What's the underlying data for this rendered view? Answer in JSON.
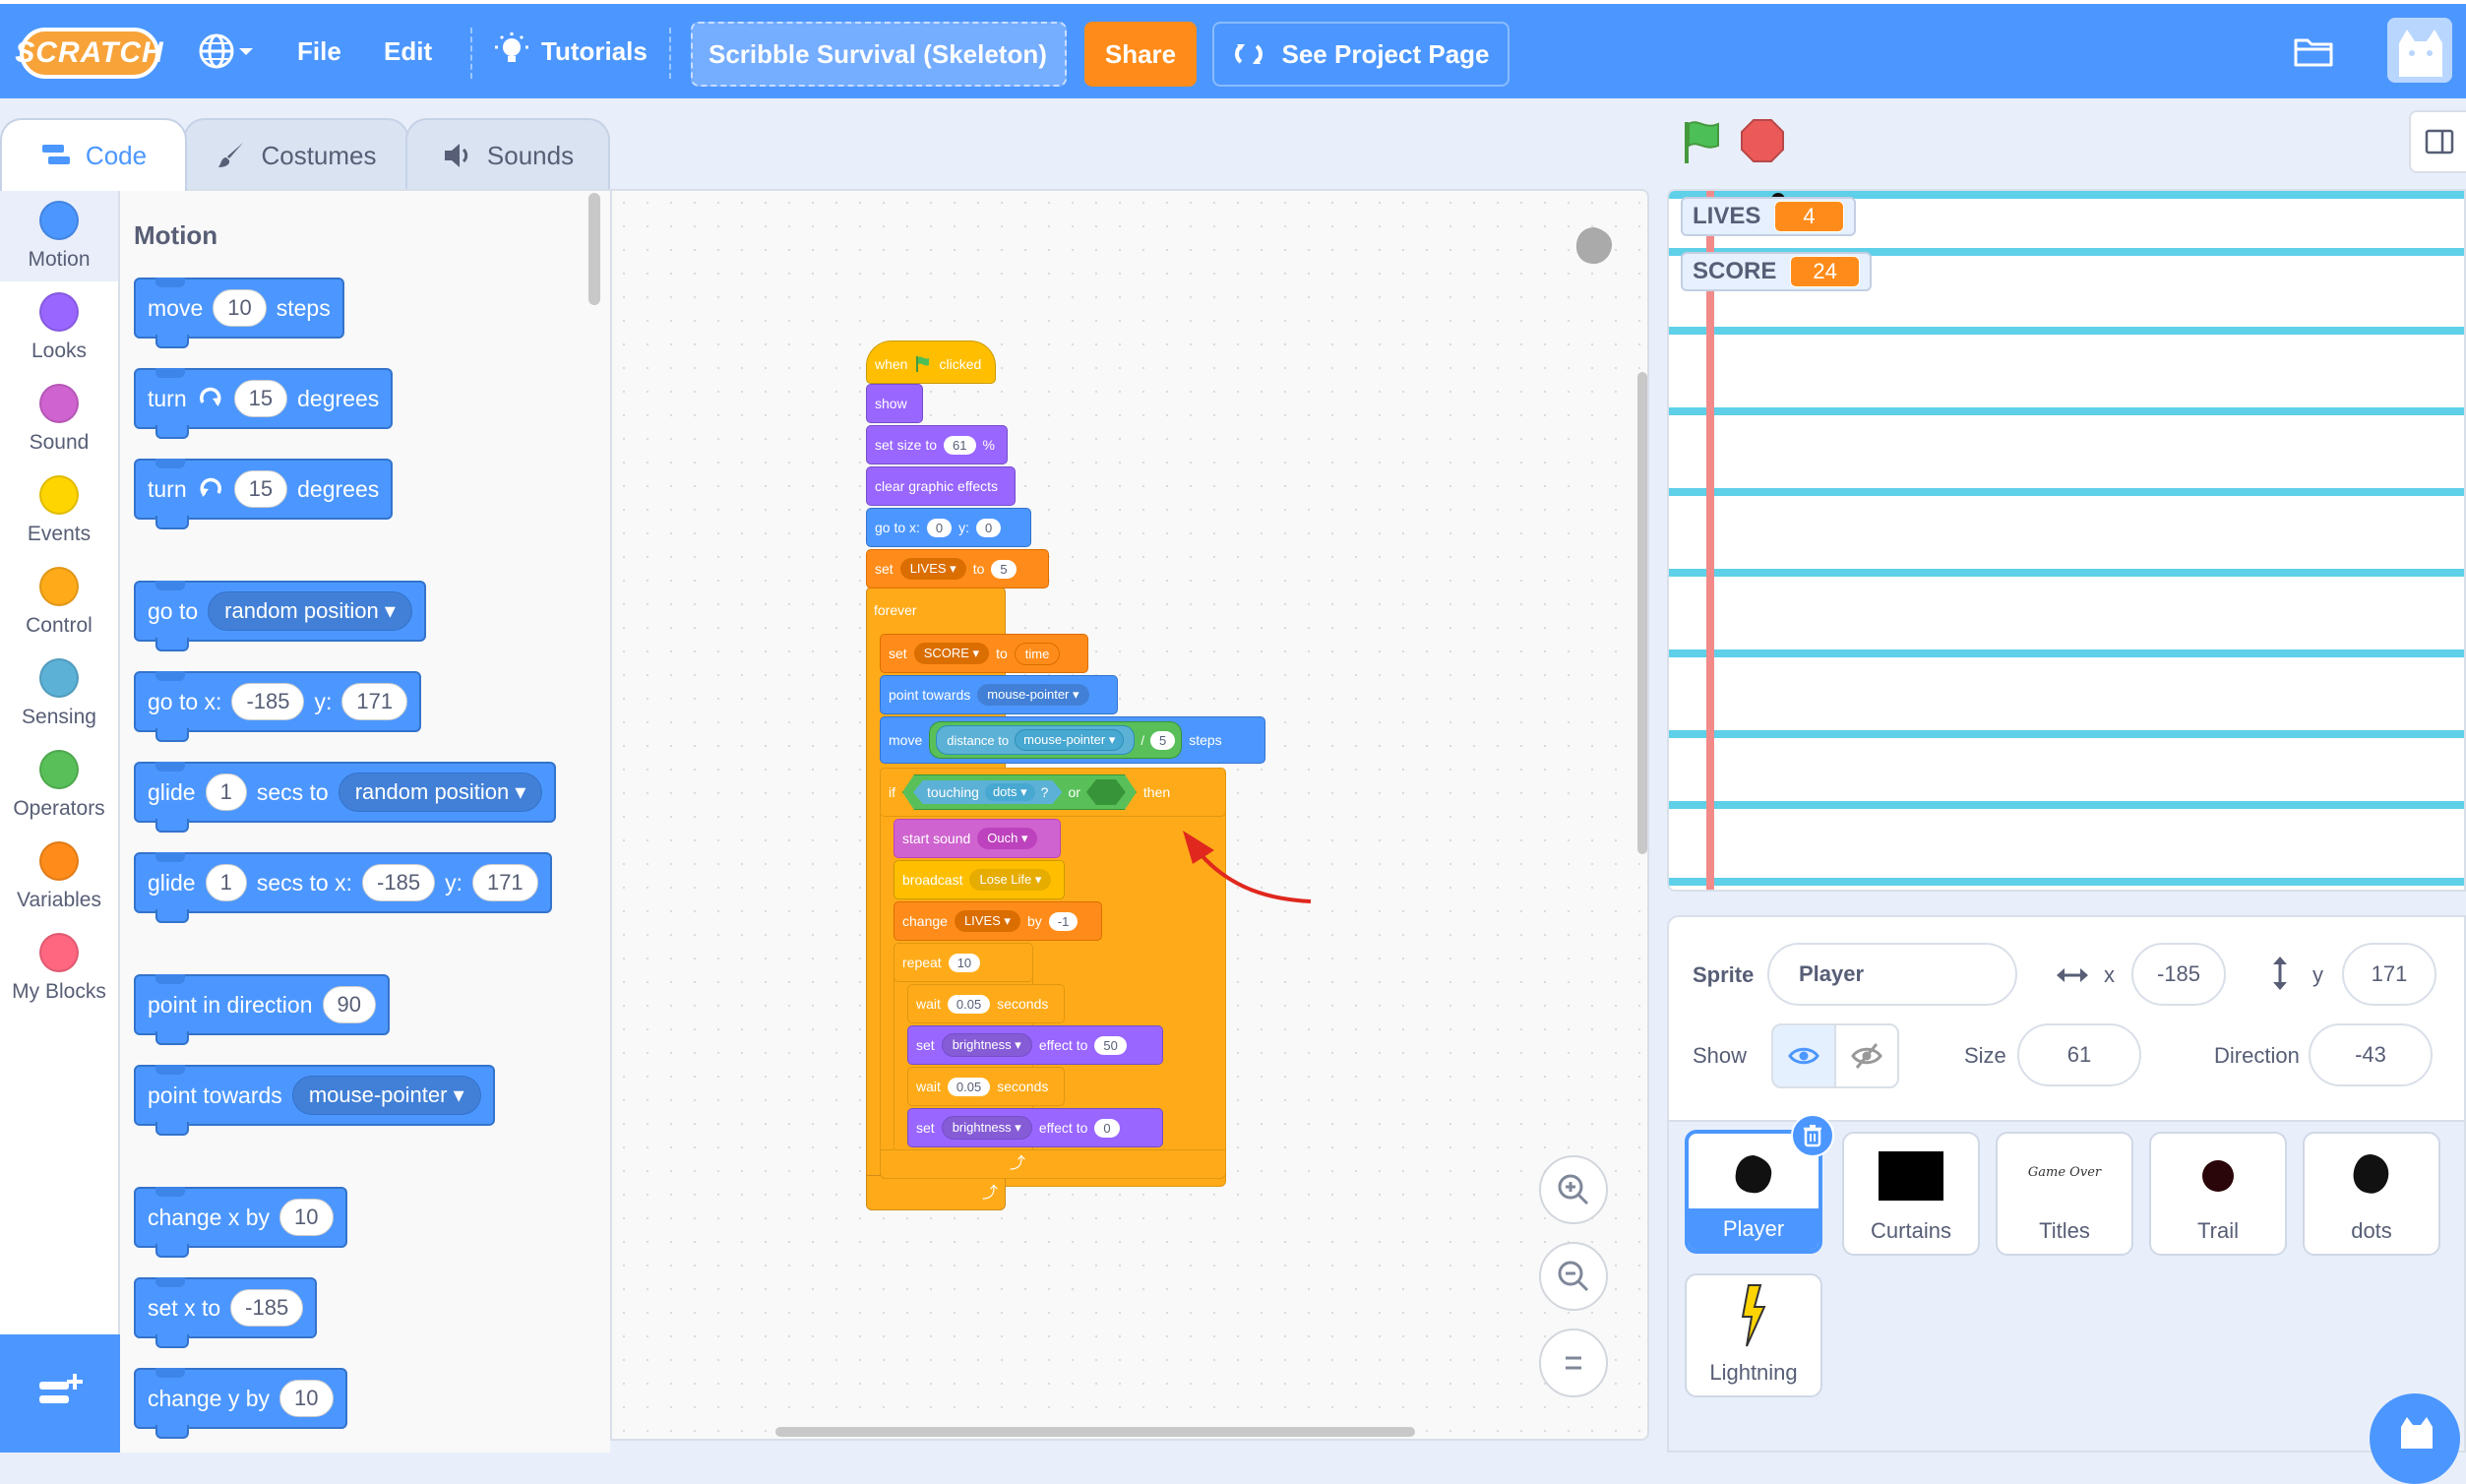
{
  "menubar": {
    "logo": "SCRATCH",
    "file": "File",
    "edit": "Edit",
    "tutorials": "Tutorials",
    "project_title": "Scribble Survival (Skeleton)",
    "share": "Share",
    "see_project_page": "See Project Page"
  },
  "tabs": {
    "code": "Code",
    "costumes": "Costumes",
    "sounds": "Sounds"
  },
  "categories": [
    {
      "label": "Motion",
      "color": "#4c97ff"
    },
    {
      "label": "Looks",
      "color": "#9966ff"
    },
    {
      "label": "Sound",
      "color": "#cf63cf"
    },
    {
      "label": "Events",
      "color": "#ffd500"
    },
    {
      "label": "Control",
      "color": "#ffab19"
    },
    {
      "label": "Sensing",
      "color": "#5cb1d6"
    },
    {
      "label": "Operators",
      "color": "#59c059"
    },
    {
      "label": "Variables",
      "color": "#ff8c1a"
    },
    {
      "label": "My Blocks",
      "color": "#ff6680"
    }
  ],
  "palette": {
    "title": "Motion",
    "move": {
      "a": "move",
      "v": "10",
      "b": "steps"
    },
    "turn_right": {
      "a": "turn",
      "v": "15",
      "b": "degrees"
    },
    "turn_left": {
      "a": "turn",
      "v": "15",
      "b": "degrees"
    },
    "goto": {
      "a": "go to",
      "d": "random position"
    },
    "goto_xy": {
      "a": "go to x:",
      "x": "-185",
      "b": "y:",
      "y": "171"
    },
    "glide": {
      "a": "glide",
      "v": "1",
      "b": "secs to",
      "d": "random position"
    },
    "glide_xy": {
      "a": "glide",
      "v": "1",
      "b": "secs to x:",
      "x": "-185",
      "c": "y:",
      "y": "171"
    },
    "point_dir": {
      "a": "point in direction",
      "v": "90"
    },
    "point_towards": {
      "a": "point towards",
      "d": "mouse-pointer"
    },
    "change_x": {
      "a": "change x by",
      "v": "10"
    },
    "set_x": {
      "a": "set x to",
      "v": "-185"
    },
    "change_y": {
      "a": "change y by",
      "v": "10"
    }
  },
  "script": {
    "hat": {
      "a": "when",
      "b": "clicked"
    },
    "show": "show",
    "set_size": {
      "a": "set size to",
      "v": "61",
      "b": "%"
    },
    "clear": "clear graphic effects",
    "goto": {
      "a": "go to x:",
      "x": "0",
      "b": "y:",
      "y": "0"
    },
    "set_lives": {
      "a": "set",
      "d": "LIVES",
      "b": "to",
      "v": "5"
    },
    "forever": "forever",
    "set_score": {
      "a": "set",
      "d": "SCORE",
      "b": "to",
      "v": "time"
    },
    "point_towards": {
      "a": "point towards",
      "d": "mouse-pointer"
    },
    "move": {
      "a": "move",
      "b": "distance to",
      "d": "mouse-pointer",
      "op": "/",
      "v": "5",
      "c": "steps"
    },
    "if": {
      "a": "if",
      "b": "touching",
      "d": "dots",
      "q": "?",
      "or": "or",
      "then": "then"
    },
    "start_sound": {
      "a": "start sound",
      "d": "Ouch"
    },
    "broadcast": {
      "a": "broadcast",
      "d": "Lose Life"
    },
    "change_lives": {
      "a": "change",
      "d": "LIVES",
      "b": "by",
      "v": "-1"
    },
    "repeat": {
      "a": "repeat",
      "v": "10"
    },
    "wait1": {
      "a": "wait",
      "v": "0.05",
      "b": "seconds"
    },
    "set_bright1": {
      "a": "set",
      "d": "brightness",
      "b": "effect to",
      "v": "50"
    },
    "wait2": {
      "a": "wait",
      "v": "0.05",
      "b": "seconds"
    },
    "set_bright2": {
      "a": "set",
      "d": "brightness",
      "b": "effect to",
      "v": "0"
    }
  },
  "stage": {
    "monitors": [
      {
        "label": "LIVES",
        "value": "4"
      },
      {
        "label": "SCORE",
        "value": "24"
      }
    ]
  },
  "sprite_info": {
    "sprite_label": "Sprite",
    "sprite_name": "Player",
    "x_label": "x",
    "x": "-185",
    "y_label": "y",
    "y": "171",
    "show_label": "Show",
    "size_label": "Size",
    "size": "61",
    "direction_label": "Direction",
    "direction": "-43"
  },
  "sprites": [
    "Player",
    "Curtains",
    "Titles",
    "Trail",
    "dots",
    "Lightning"
  ],
  "titles_thumb_text": "Game Over"
}
